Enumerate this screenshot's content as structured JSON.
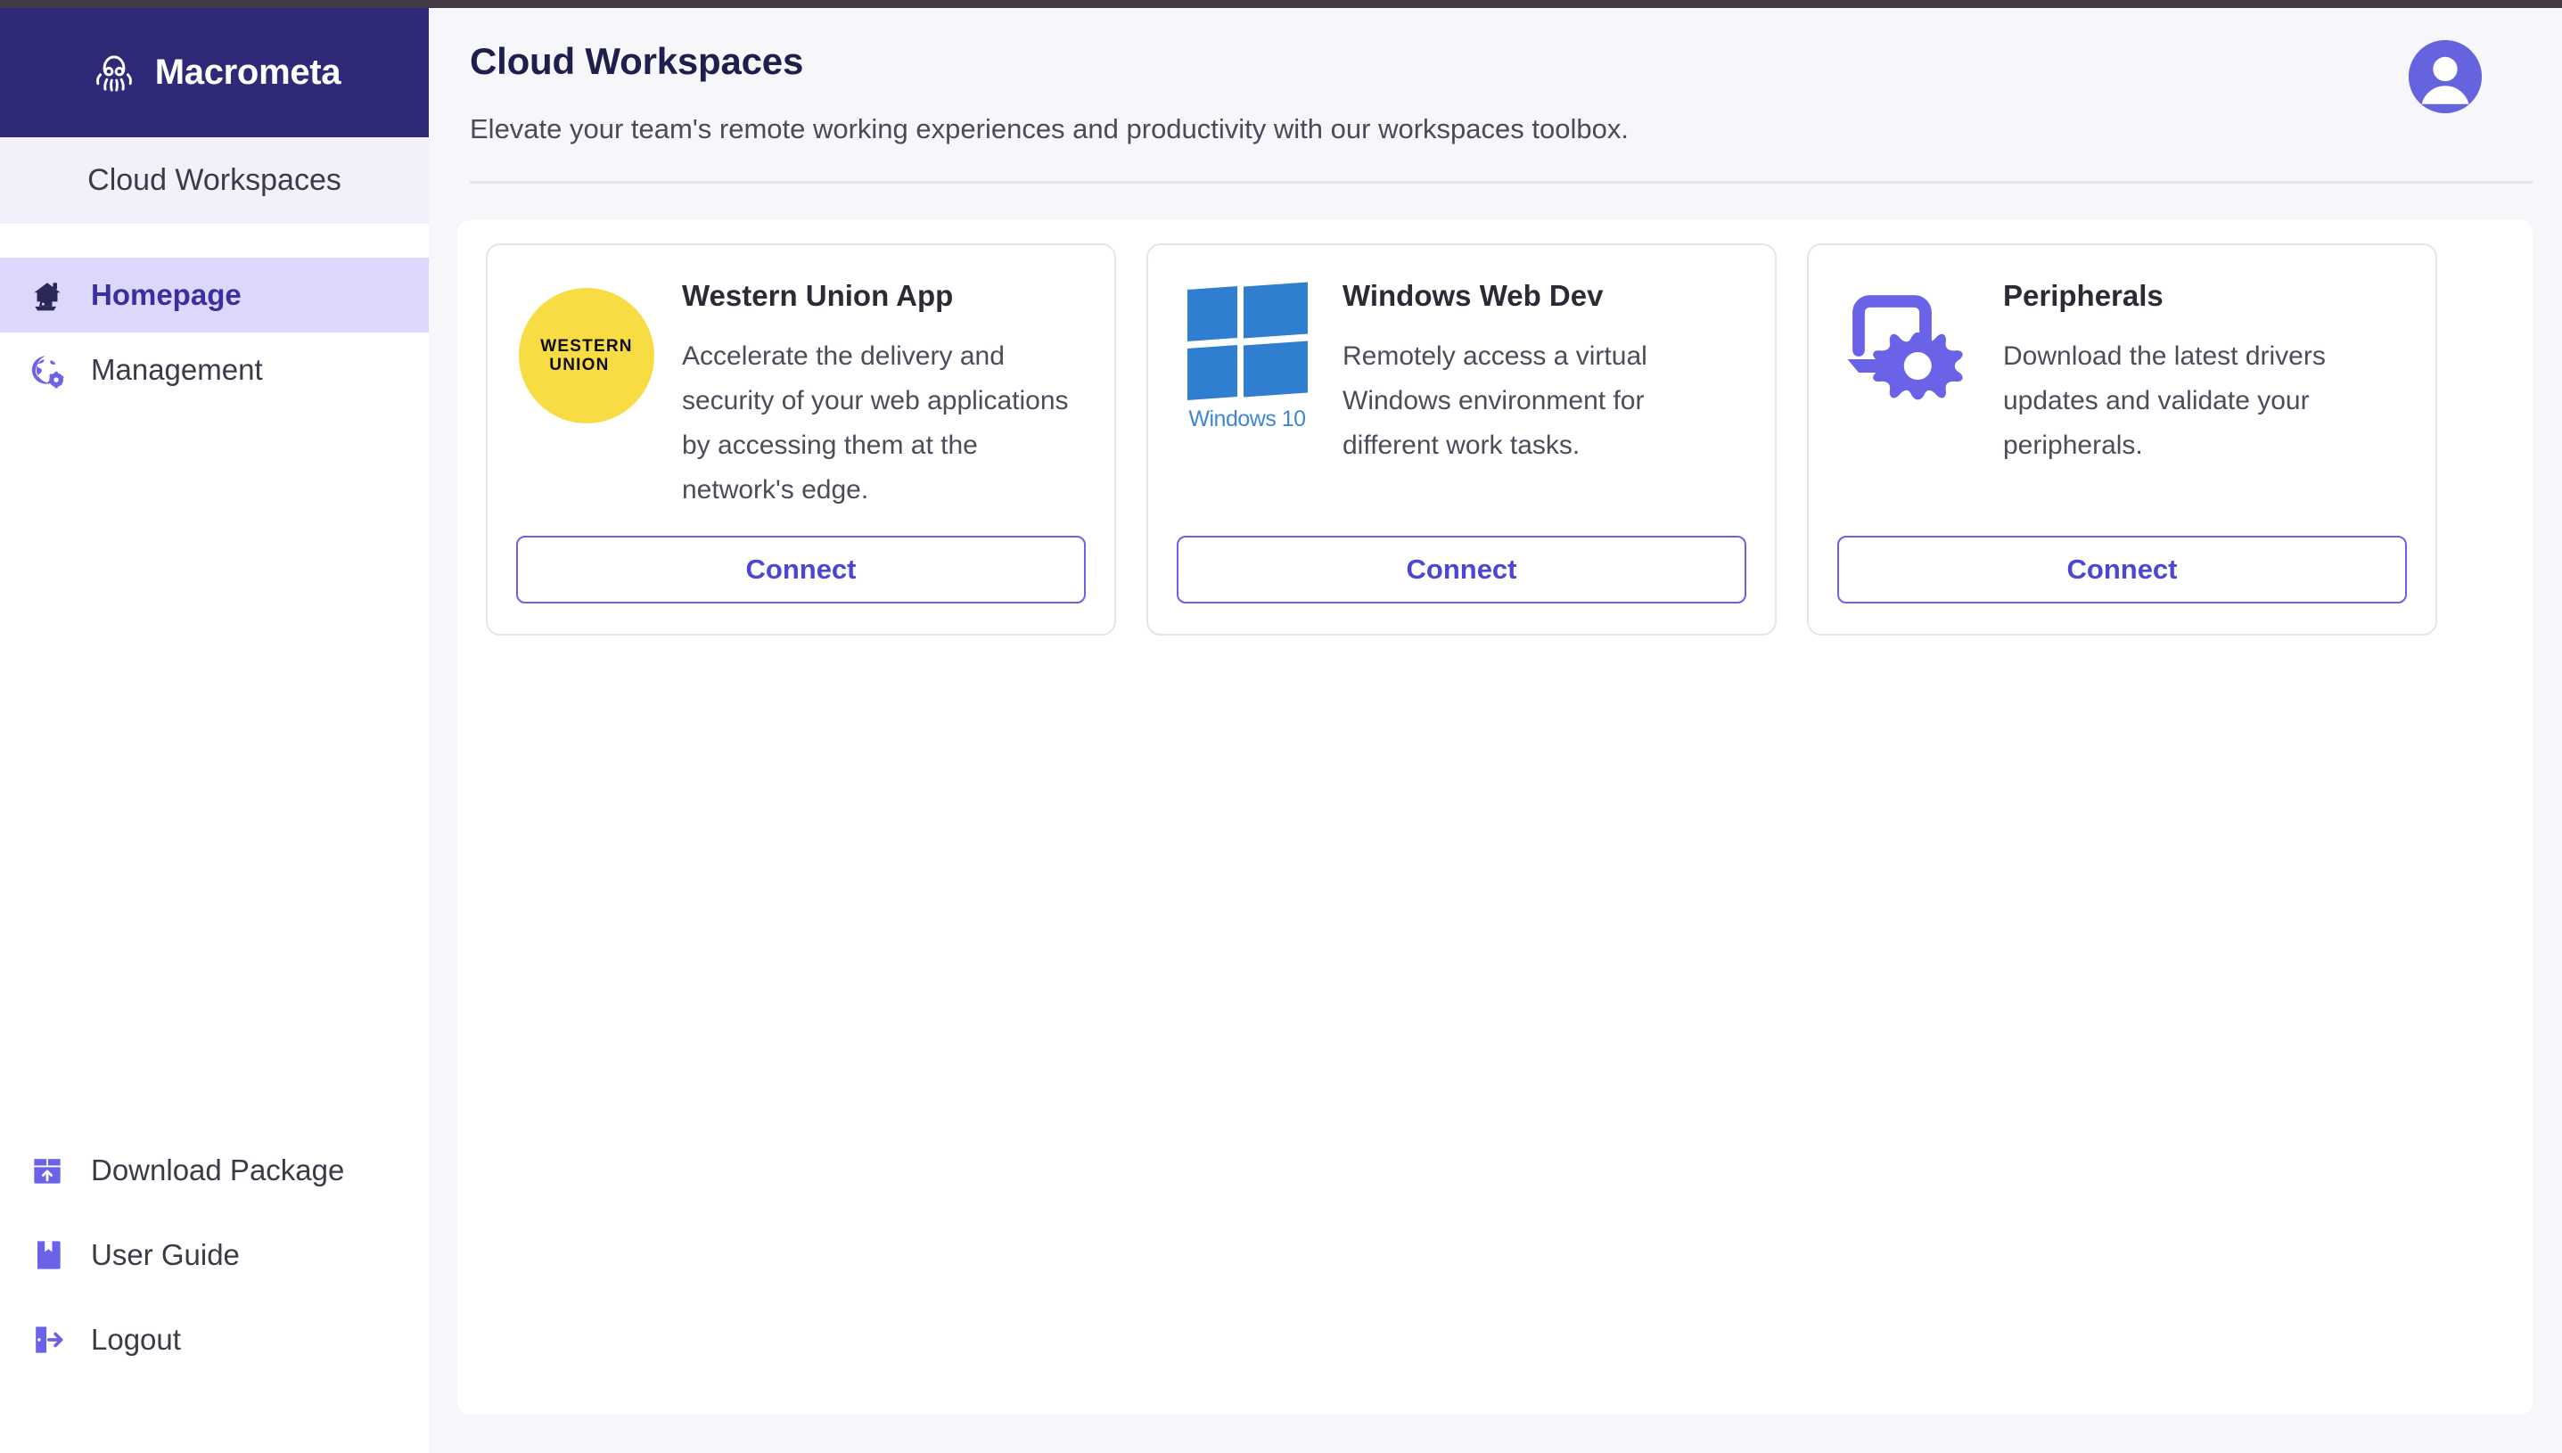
{
  "brand": {
    "name": "Macrometa",
    "logo_icon": "octopus-logo-icon"
  },
  "sidebar": {
    "workspace_label": "Cloud Workspaces",
    "nav_top": [
      {
        "label": "Homepage",
        "icon": "home-office-icon",
        "active": true
      },
      {
        "label": "Management",
        "icon": "globe-gear-icon",
        "active": false
      }
    ],
    "nav_bottom": [
      {
        "label": "Download Package",
        "icon": "package-download-icon"
      },
      {
        "label": "User Guide",
        "icon": "book-icon"
      },
      {
        "label": "Logout",
        "icon": "logout-icon"
      }
    ]
  },
  "header": {
    "title": "Cloud Workspaces",
    "subtitle": "Elevate your team's remote working experiences and productivity with our workspaces toolbox.",
    "avatar_icon": "user-avatar-icon"
  },
  "cards": [
    {
      "title": "Western Union App",
      "description": "Accelerate the delivery and security of your web applications by accessing them at the network's edge.",
      "button_label": "Connect",
      "logo_icon": "western-union-logo-icon",
      "logo_line1": "WESTERN",
      "logo_line2": "UNION"
    },
    {
      "title": "Windows Web Dev",
      "description": "Remotely access a virtual Windows environment for different work tasks.",
      "button_label": "Connect",
      "logo_icon": "windows-10-logo-icon",
      "logo_label": "Windows 10"
    },
    {
      "title": "Peripherals",
      "description": "Download the latest drivers updates and validate your peripherals.",
      "button_label": "Connect",
      "logo_icon": "device-settings-icon"
    }
  ],
  "colors": {
    "brand_navy": "#2e2a78",
    "accent_purple": "#6a63e8",
    "active_nav_bg": "#ddd8fb",
    "page_bg": "#f7f6fb",
    "western_union_yellow": "#f7dd43",
    "windows_blue": "#2f7ed0"
  }
}
